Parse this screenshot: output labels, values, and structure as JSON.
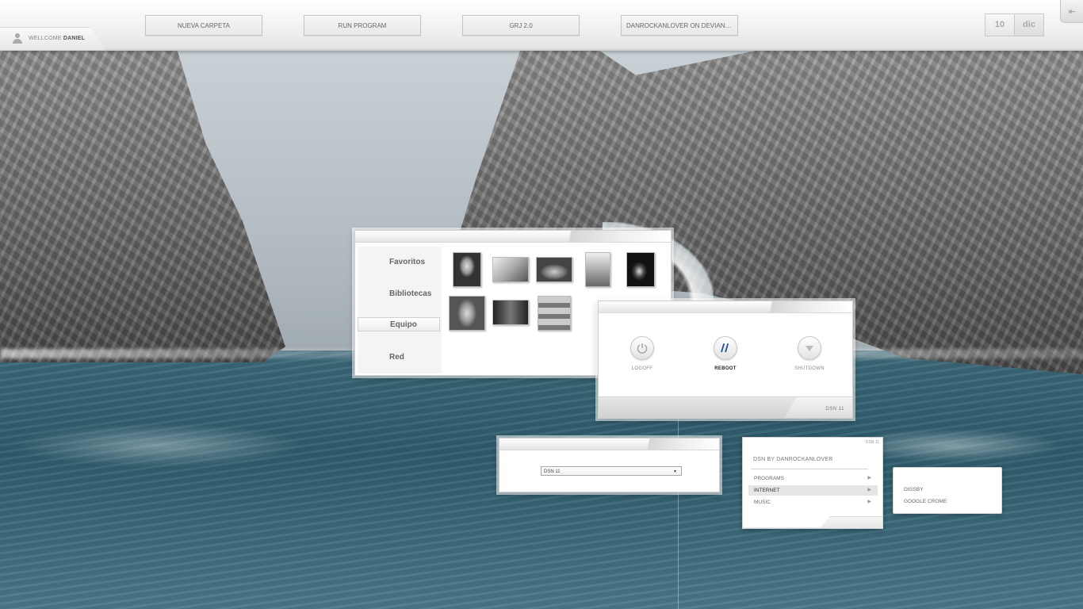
{
  "topbar": {
    "welcome_prefix": "WELLCOME",
    "welcome_user": "DANIEL",
    "buttons": [
      "NUEVA CARPETA",
      "RUN PROGRAM",
      "GRJ 2.0",
      "DANROCKANLOVER ON DEVIANTART"
    ],
    "date_day": "10",
    "date_month": "dic",
    "corner_icon": "back-arrow-icon",
    "corner_glyph": "⇤"
  },
  "explorer": {
    "nav": [
      "Favoritos",
      "Bibliotecas",
      "Equipo",
      "Red"
    ],
    "selected_nav": "Equipo",
    "thumbnail_count": 8
  },
  "power": {
    "buttons": [
      {
        "label": "LOGOFF",
        "icon": "power-icon"
      },
      {
        "label": "REBOOT",
        "icon": "reboot-icon"
      },
      {
        "label": "SHUTDOWN",
        "icon": "shutdown-icon"
      }
    ],
    "active": "REBOOT",
    "brand": "DSN 11"
  },
  "selector": {
    "value": "DSN 11",
    "arrow": "▾"
  },
  "startmenu": {
    "version": "DSN 11",
    "header": "DSN BY DANROCKANLOVER",
    "items": [
      "PROGRAMS",
      "INTERNET",
      "MUSIC"
    ],
    "highlighted": "INTERNET",
    "submenu": [
      "DIGSBY",
      "GOOGLE CROME"
    ]
  },
  "colors": {
    "topbar_bg": "#efefef",
    "window_bg": "#ffffff",
    "sea": "#2e5c6c",
    "accent_reboot": "#1f4e9a"
  }
}
